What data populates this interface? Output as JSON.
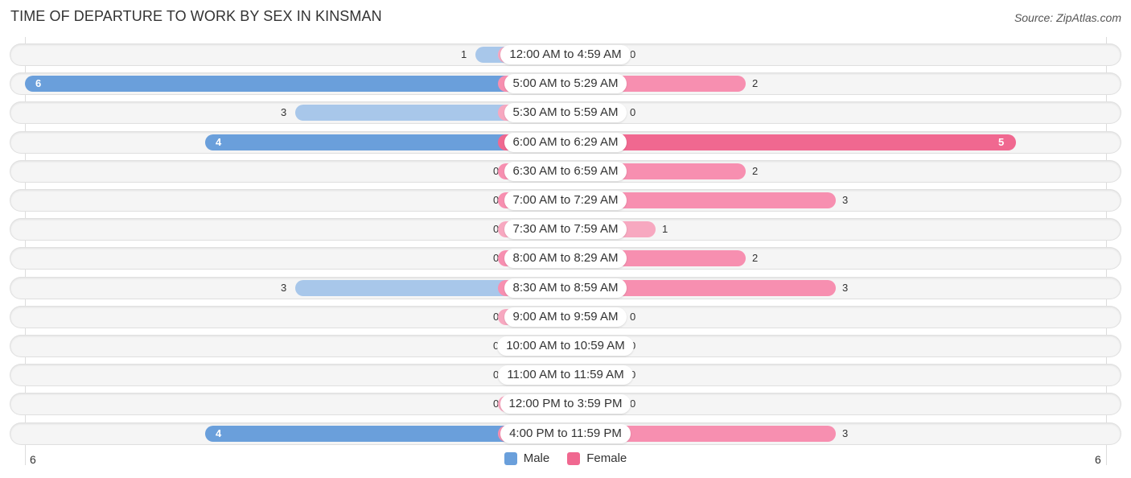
{
  "chart_data": {
    "type": "bar",
    "orientation": "horizontal-diverging",
    "title": "TIME OF DEPARTURE TO WORK BY SEX IN KINSMAN",
    "source": "Source: ZipAtlas.com",
    "categories": [
      "12:00 AM to 4:59 AM",
      "5:00 AM to 5:29 AM",
      "5:30 AM to 5:59 AM",
      "6:00 AM to 6:29 AM",
      "6:30 AM to 6:59 AM",
      "7:00 AM to 7:29 AM",
      "7:30 AM to 7:59 AM",
      "8:00 AM to 8:29 AM",
      "8:30 AM to 8:59 AM",
      "9:00 AM to 9:59 AM",
      "10:00 AM to 10:59 AM",
      "11:00 AM to 11:59 AM",
      "12:00 PM to 3:59 PM",
      "4:00 PM to 11:59 PM"
    ],
    "series": [
      {
        "name": "Male",
        "color": "#6a9fdb",
        "values": [
          1,
          6,
          3,
          4,
          0,
          0,
          0,
          0,
          3,
          0,
          0,
          0,
          0,
          4
        ]
      },
      {
        "name": "Female",
        "color": "#f06890",
        "values": [
          0,
          2,
          0,
          5,
          2,
          3,
          1,
          2,
          3,
          0,
          0,
          0,
          0,
          3
        ]
      }
    ],
    "xlim": [
      -6,
      6
    ],
    "axis_tick_labels": {
      "left": "6",
      "right": "6"
    },
    "legend": {
      "position": "bottom-center",
      "entries": [
        "Male",
        "Female"
      ]
    },
    "grid": false
  },
  "colors": {
    "male_strong": "#6a9fdb",
    "male_light": "#a8c7ea",
    "female_strong": "#f06890",
    "female_light": "#f7a8c0",
    "row_bg": "#f5f5f5"
  }
}
